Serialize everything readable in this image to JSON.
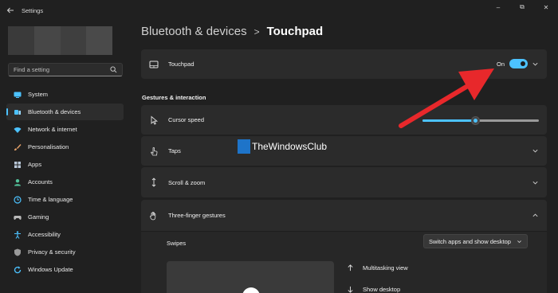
{
  "window": {
    "title": "Settings",
    "controls": {
      "minimize": "–",
      "maximize": "⧉",
      "close": "✕"
    }
  },
  "search": {
    "placeholder": "Find a setting"
  },
  "sidebar": {
    "items": [
      {
        "label": "System",
        "icon": "system-icon",
        "color": "#4cc2ff"
      },
      {
        "label": "Bluetooth & devices",
        "icon": "bluetooth-icon",
        "color": "#4cc2ff",
        "active": true
      },
      {
        "label": "Network & internet",
        "icon": "wifi-icon",
        "color": "#4cc2ff"
      },
      {
        "label": "Personalisation",
        "icon": "brush-icon",
        "color": "#e8a36a"
      },
      {
        "label": "Apps",
        "icon": "apps-icon",
        "color": "#b9c7d8"
      },
      {
        "label": "Accounts",
        "icon": "account-icon",
        "color": "#52c29a"
      },
      {
        "label": "Time & language",
        "icon": "globe-clock-icon",
        "color": "#4cc2ff"
      },
      {
        "label": "Gaming",
        "icon": "gamepad-icon",
        "color": "#b9b9b9"
      },
      {
        "label": "Accessibility",
        "icon": "accessibility-icon",
        "color": "#4cc2ff"
      },
      {
        "label": "Privacy & security",
        "icon": "shield-icon",
        "color": "#9a9a9a"
      },
      {
        "label": "Windows Update",
        "icon": "update-icon",
        "color": "#4cc2ff"
      }
    ]
  },
  "breadcrumb": {
    "parent": "Bluetooth & devices",
    "separator": ">",
    "current": "Touchpad"
  },
  "touchpad_card": {
    "label": "Touchpad",
    "toggle_text": "On",
    "toggle_on": true
  },
  "section": {
    "title": "Gestures & interaction"
  },
  "cursor_speed": {
    "label": "Cursor speed",
    "value_fraction": 0.45
  },
  "taps": {
    "label": "Taps"
  },
  "scroll_zoom": {
    "label": "Scroll & zoom"
  },
  "three_finger": {
    "label": "Three-finger gestures",
    "swipes_label": "Swipes",
    "swipes_value": "Switch apps and show desktop",
    "gestures": [
      {
        "label": "Multitasking view",
        "icon": "arrow-up-icon"
      },
      {
        "label": "Show desktop",
        "icon": "arrow-down-icon"
      }
    ]
  },
  "watermark": {
    "text": "TheWindowsClub"
  },
  "colors": {
    "accent": "#4cc2ff",
    "annotation_arrow": "#e8282b",
    "background": "#202020",
    "card": "#2b2b2b"
  }
}
